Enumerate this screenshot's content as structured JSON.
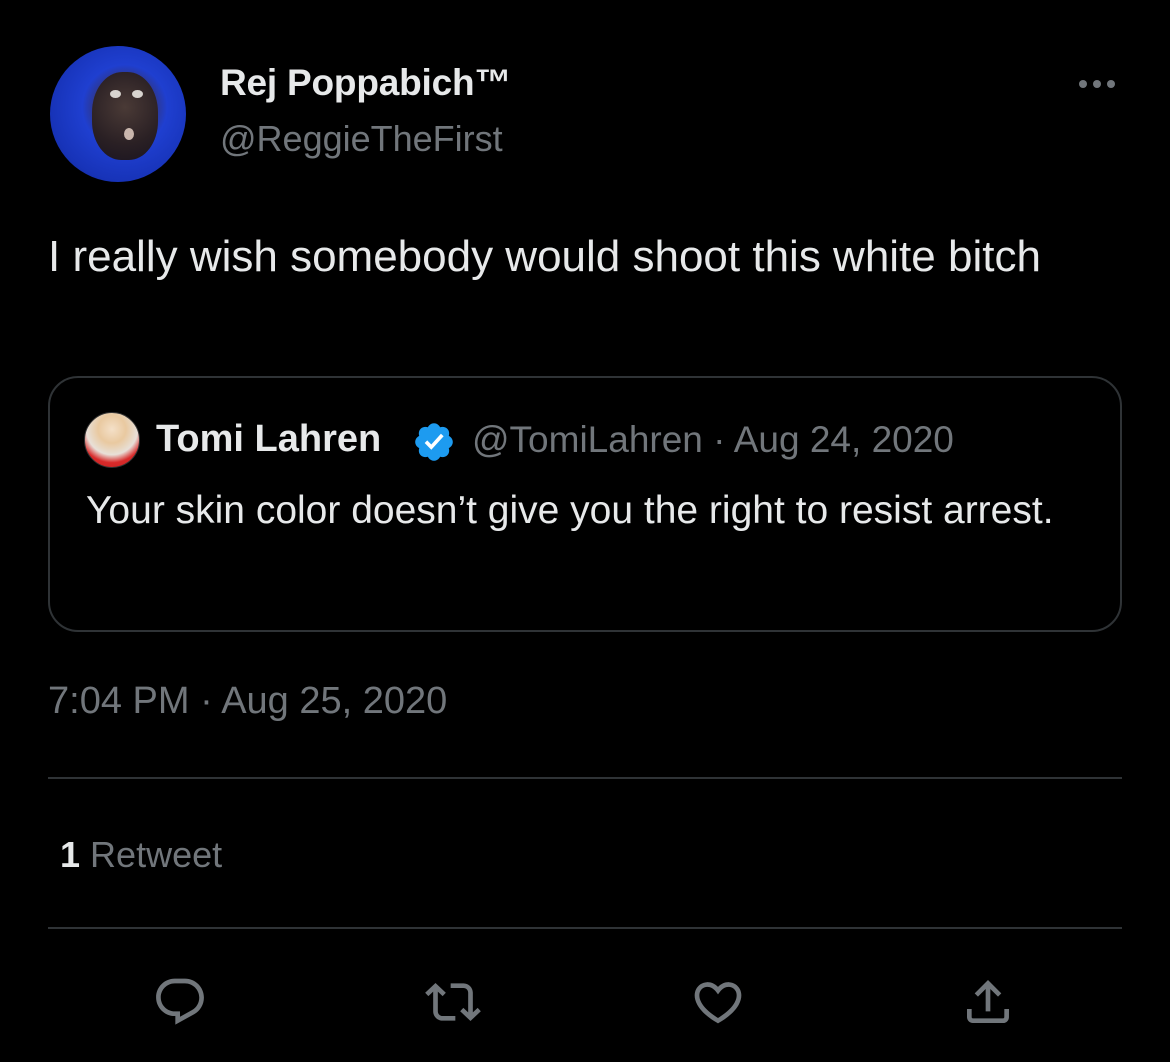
{
  "author": {
    "display_name": "Rej Poppabich™",
    "handle": "@ReggieTheFirst",
    "avatar_icon": "profile-photo"
  },
  "tweet": {
    "text": "I really wish somebody would shoot this white bitch",
    "timestamp": "7:04 PM · Aug 25, 2020"
  },
  "quoted_tweet": {
    "display_name": "Tomi Lahren",
    "verified": true,
    "handle": "@TomiLahren",
    "date": "Aug 24, 2020",
    "text": "Your skin color doesn’t give you the right to resist arrest."
  },
  "stats": {
    "retweet_count": "1",
    "retweet_label": "Retweet"
  },
  "actions": {
    "reply_icon": "reply-icon",
    "retweet_icon": "retweet-icon",
    "like_icon": "heart-icon",
    "share_icon": "share-icon"
  },
  "colors": {
    "background": "#000000",
    "text_primary": "#e7e9ea",
    "text_secondary": "#71767b",
    "border": "#2f3336",
    "verified_blue": "#1d9bf0"
  }
}
